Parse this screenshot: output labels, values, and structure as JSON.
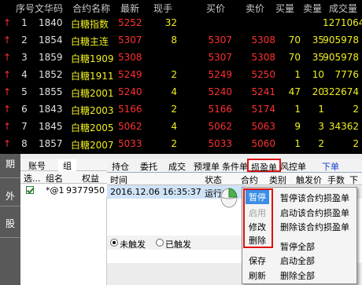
{
  "quote_header": {
    "idx": "序号",
    "code": "文华码",
    "name": "合约名称",
    "last": "最新",
    "vol": "现手",
    "bid": "买价",
    "ask": "卖价",
    "bid_qty": "买量",
    "ask_qty": "卖量",
    "total": "成交量"
  },
  "quote_rows": [
    {
      "arrow": "↑",
      "idx": "1",
      "code": "1840",
      "name": "白糖指数",
      "last": "5252",
      "vol": "32",
      "bid": "",
      "ask": "",
      "bid_qty": "",
      "ask_qty": "",
      "total": "1271064"
    },
    {
      "arrow": "↑",
      "idx": "2",
      "code": "1854",
      "name": "白糖主连",
      "last": "5307",
      "vol": "8",
      "bid": "5307",
      "ask": "5308",
      "bid_qty": "70",
      "ask_qty": "35",
      "total": "905978"
    },
    {
      "arrow": "↑",
      "idx": "3",
      "code": "1859",
      "name": "白糖1909",
      "last": "5308",
      "vol": "",
      "bid": "5307",
      "ask": "5308",
      "bid_qty": "70",
      "ask_qty": "35",
      "total": "905978"
    },
    {
      "arrow": "↑",
      "idx": "4",
      "code": "1852",
      "name": "白糖1911",
      "last": "5249",
      "vol": "2",
      "bid": "5249",
      "ask": "5250",
      "bid_qty": "1",
      "ask_qty": "10",
      "total": "7776"
    },
    {
      "arrow": "↑",
      "idx": "5",
      "code": "1855",
      "name": "白糖2001",
      "last": "5240",
      "vol": "4",
      "bid": "5240",
      "ask": "5241",
      "bid_qty": "47",
      "ask_qty": "20",
      "total": "322674"
    },
    {
      "arrow": "↑",
      "idx": "6",
      "code": "1843",
      "name": "白糖2003",
      "last": "5166",
      "vol": "2",
      "bid": "5166",
      "ask": "5174",
      "bid_qty": "1",
      "ask_qty": "1",
      "total": "2"
    },
    {
      "arrow": "↑",
      "idx": "7",
      "code": "1845",
      "name": "白糖2005",
      "last": "5062",
      "vol": "4",
      "bid": "5062",
      "ask": "5063",
      "bid_qty": "9",
      "ask_qty": "3",
      "total": "34362"
    },
    {
      "arrow": "↑",
      "idx": "8",
      "code": "1857",
      "name": "白糖2007",
      "last": "5033",
      "vol": "2",
      "bid": "5033",
      "ask": "5060",
      "bid_qty": "1",
      "ask_qty": "2",
      "total": "2"
    },
    {
      "arrow": "↑",
      "idx": "",
      "code": "",
      "name": "郑糖指数",
      "last": "",
      "vol": "",
      "bid": "",
      "ask": "",
      "bid_qty": "",
      "ask_qty": "",
      "total": ""
    }
  ],
  "side_labels": [
    "期",
    "外",
    "股"
  ],
  "account": {
    "tab1": "账号",
    "tab2": "组",
    "col_sel": "选...",
    "col_group": "组名",
    "col_rights": "权益",
    "row_group": "*@1",
    "row_rights": "9377950"
  },
  "tabs": [
    "持仓",
    "委托",
    "成交",
    "预埋单",
    "条件单",
    "损盈单",
    "风控单",
    "下单"
  ],
  "grid_header": [
    "时间",
    "状态",
    "合约",
    "类别",
    "触发价",
    "手数",
    "下"
  ],
  "grid_row": {
    "time": "2016.12.06 16:35:37",
    "status": "运行中"
  },
  "filter": {
    "opt1": "未触发",
    "opt2": "已触发"
  },
  "menu_left": [
    "暂停",
    "启用",
    "修改",
    "删除",
    "保存",
    "刷新"
  ],
  "menu_right": [
    "暂停该合约损盈单",
    "启动该合约损盈单",
    "删除该合约损盈单",
    "暂停全部",
    "启动全部",
    "删除全部"
  ],
  "colors": {
    "up": "#ff3030",
    "name": "#f0f020",
    "highlight": "#3a8ee6",
    "box": "#e01010"
  }
}
